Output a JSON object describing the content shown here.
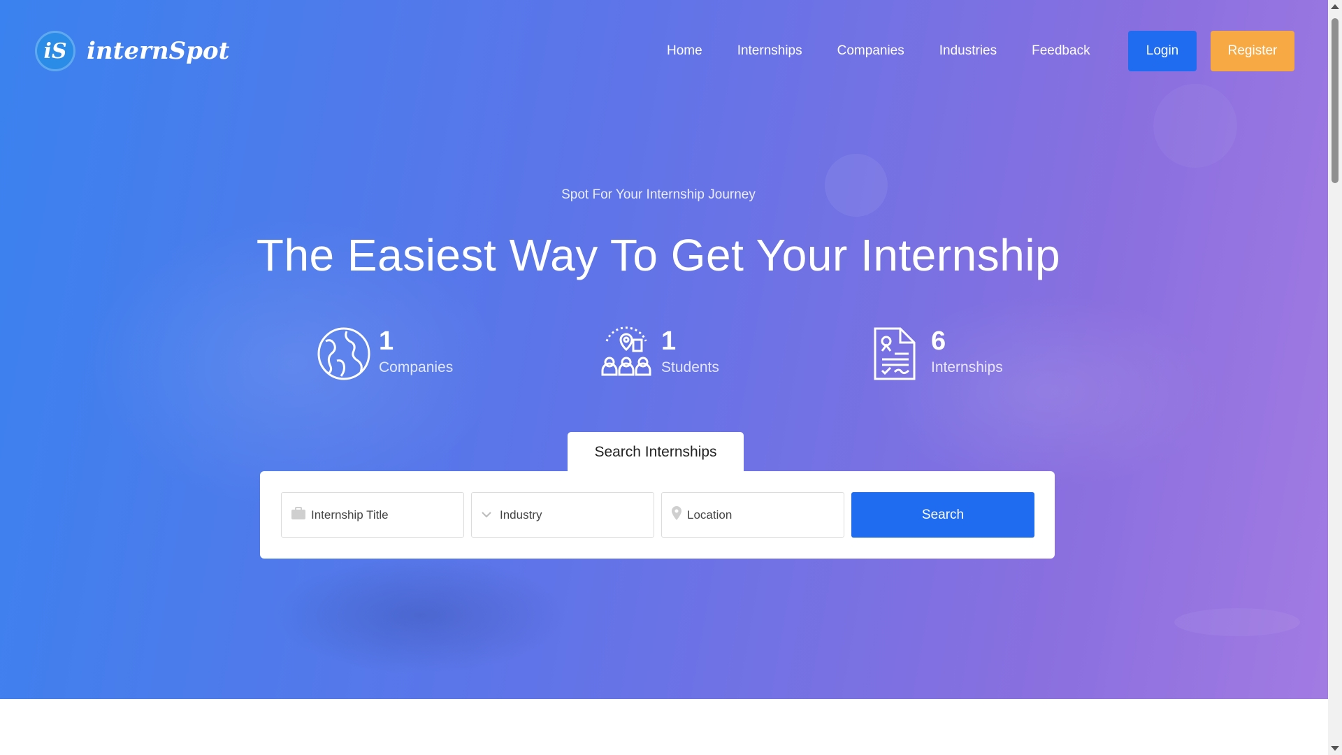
{
  "brand": {
    "logo_mark": "iS",
    "name": "internSpot"
  },
  "nav": {
    "items": [
      {
        "label": "Home"
      },
      {
        "label": "Internships"
      },
      {
        "label": "Companies"
      },
      {
        "label": "Industries"
      },
      {
        "label": "Feedback"
      }
    ],
    "login_label": "Login",
    "register_label": "Register"
  },
  "hero": {
    "tagline": "Spot For Your Internship Journey",
    "headline": "The Easiest Way To Get Your Internship"
  },
  "stats": [
    {
      "icon": "globe-icon",
      "value": "1",
      "label": "Companies"
    },
    {
      "icon": "students-icon",
      "value": "1",
      "label": "Students"
    },
    {
      "icon": "document-icon",
      "value": "6",
      "label": "Internships"
    }
  ],
  "search": {
    "tab_label": "Search Internships",
    "title_placeholder": "Internship Title",
    "industry_selected": "Industry",
    "location_placeholder": "Location",
    "button_label": "Search"
  },
  "colors": {
    "primary": "#1f6cf0",
    "accent": "#f7a944",
    "hero_gradient_start": "#3a82ef",
    "hero_gradient_end": "#a27be2"
  }
}
